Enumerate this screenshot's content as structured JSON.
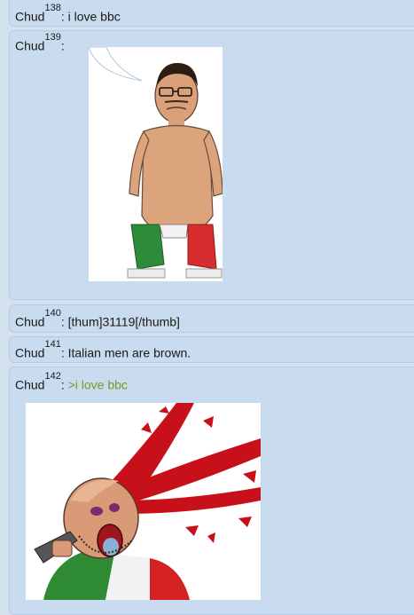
{
  "posts": [
    {
      "author": "Chud",
      "number": "138",
      "text": "i love bbc",
      "greentext": false
    },
    {
      "author": "Chud",
      "number": "139",
      "text": "",
      "greentext": false,
      "image": "cartoon-man-green-white-red-pants"
    },
    {
      "author": "Chud",
      "number": "140",
      "text": "[thum]31119[/thumb]",
      "greentext": false
    },
    {
      "author": "Chud",
      "number": "141",
      "text": "Italian men are brown.",
      "greentext": false
    },
    {
      "author": "Chud",
      "number": "142",
      "text": ">i love bbc",
      "greentext": true,
      "image": "cartoon-man-gun-blood-splatter"
    }
  ],
  "colors": {
    "page_background": "#d3e0ee",
    "post_background": "#c9dbee",
    "greentext": "#789922"
  }
}
